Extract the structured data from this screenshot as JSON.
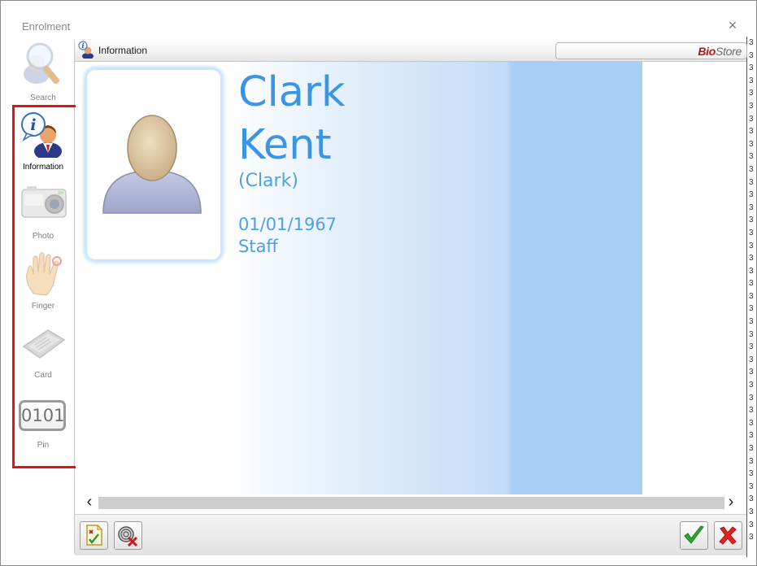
{
  "window": {
    "title": "Enrolment",
    "close_glyph": "×"
  },
  "sidebar": {
    "items": [
      {
        "label": "Search",
        "icon": "search-icon"
      },
      {
        "label": "Information",
        "icon": "information-icon"
      },
      {
        "label": "Photo",
        "icon": "camera-icon"
      },
      {
        "label": "Finger",
        "icon": "hand-icon"
      },
      {
        "label": "Card",
        "icon": "card-icon"
      },
      {
        "label": "Pin",
        "icon": "pin-icon",
        "icon_text": "0101"
      }
    ],
    "active": "Information"
  },
  "panel": {
    "title": "Information",
    "brand_prefix": "Bio",
    "brand_suffix": "Store"
  },
  "person": {
    "first_name": "Clark",
    "last_name": "Kent",
    "nickname": "(Clark)",
    "dob": "01/01/1967",
    "role": "Staff"
  },
  "scrollbar": {
    "left_glyph": "‹",
    "right_glyph": "›"
  },
  "colors": {
    "accent_text": "#3a95e6",
    "highlight_box": "#e81010",
    "brand_red": "#b01818"
  }
}
